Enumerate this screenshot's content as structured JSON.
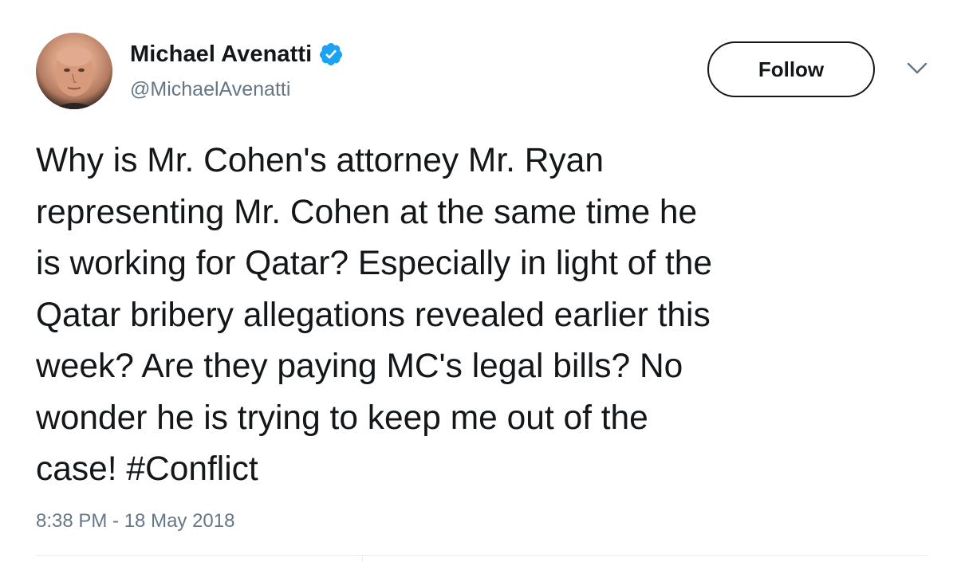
{
  "user": {
    "display_name": "Michael Avenatti",
    "handle": "@MichaelAvenatti",
    "verified": true
  },
  "actions": {
    "follow_label": "Follow"
  },
  "tweet": {
    "lines": [
      "Why is Mr. Cohen's attorney Mr. Ryan",
      "representing Mr. Cohen at the same time he",
      "is working for Qatar? Especially in light of the",
      "Qatar bribery allegations revealed earlier this",
      "week? Are they paying MC's legal bills? No",
      "wonder he is trying to keep me out of the",
      "case!  #Conflict"
    ],
    "timestamp": "8:38 PM - 18 May 2018"
  },
  "colors": {
    "text": "#14171a",
    "secondary": "#657786",
    "verified_blue": "#1da1f2",
    "divider": "#e6ecf0"
  }
}
